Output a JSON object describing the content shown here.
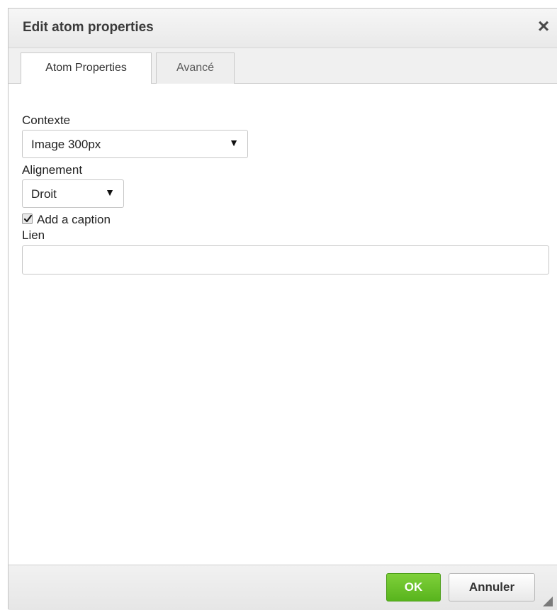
{
  "dialog": {
    "title": "Edit atom properties",
    "close_glyph": "×"
  },
  "tabs": [
    {
      "label": "Atom Properties",
      "active": true
    },
    {
      "label": "Avancé",
      "active": false
    }
  ],
  "form": {
    "contexte": {
      "label": "Contexte",
      "selected": "Image 300px",
      "arrow": "▼"
    },
    "alignement": {
      "label": "Alignement",
      "selected": "Droit",
      "arrow": "▼"
    },
    "caption": {
      "label": "Add a caption",
      "checked": true
    },
    "lien": {
      "label": "Lien",
      "value": "",
      "placeholder": ""
    }
  },
  "footer": {
    "ok_label": "OK",
    "cancel_label": "Annuler"
  },
  "colors": {
    "ok_button": "#63be26",
    "titlebar": "#efefef"
  }
}
